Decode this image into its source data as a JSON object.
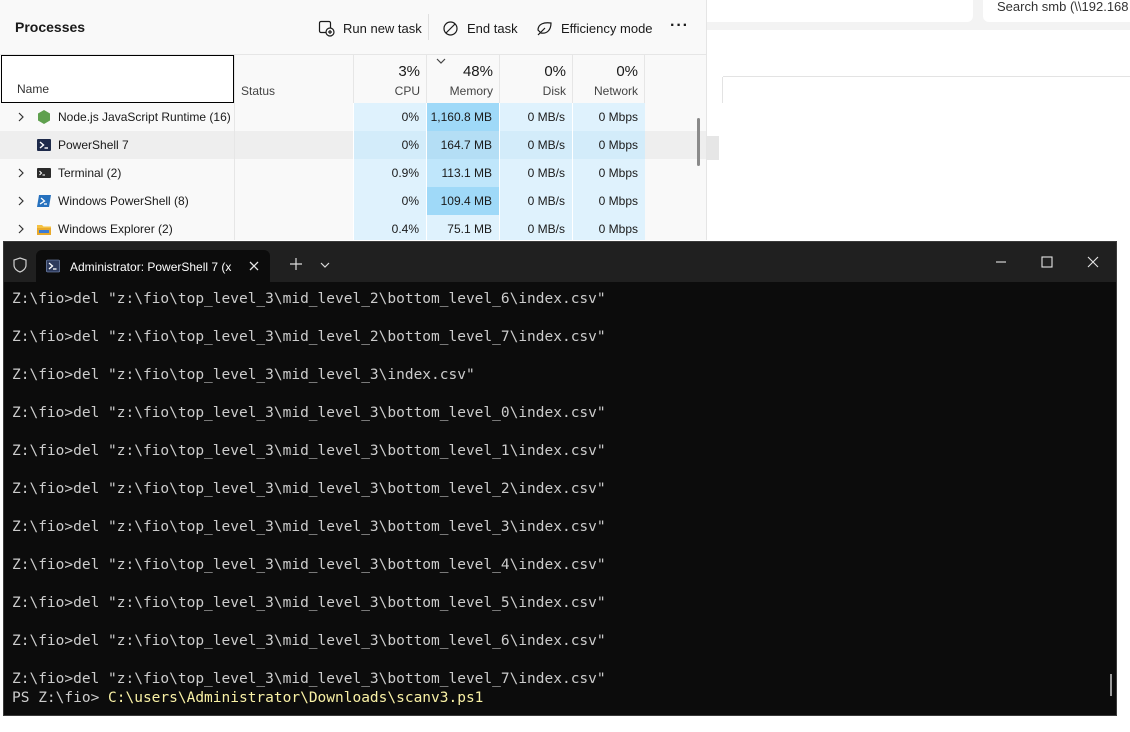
{
  "explorer": {
    "search_placeholder": "Search smb (\\\\192.168"
  },
  "taskmgr": {
    "title": "Processes",
    "commands": {
      "run_new_task": "Run new task",
      "end_task": "End task",
      "efficiency_mode": "Efficiency mode",
      "more": "···"
    },
    "columns": {
      "name": "Name",
      "status": "Status",
      "cpu": {
        "pct": "3%",
        "label": "CPU"
      },
      "memory": {
        "pct": "48%",
        "label": "Memory"
      },
      "disk": {
        "pct": "0%",
        "label": "Disk"
      },
      "network": {
        "pct": "0%",
        "label": "Network"
      }
    },
    "rows": [
      {
        "name": "Node.js JavaScript Runtime (16)",
        "cpu": "0%",
        "memory": "1,160.8 MB",
        "disk": "0 MB/s",
        "network": "0 Mbps",
        "expandable": true,
        "icon": "nodejs-icon"
      },
      {
        "name": "PowerShell 7",
        "cpu": "0%",
        "memory": "164.7 MB",
        "disk": "0 MB/s",
        "network": "0 Mbps",
        "expandable": false,
        "icon": "powershell-icon"
      },
      {
        "name": "Terminal (2)",
        "cpu": "0.9%",
        "memory": "113.1 MB",
        "disk": "0 MB/s",
        "network": "0 Mbps",
        "expandable": true,
        "icon": "terminal-icon"
      },
      {
        "name": "Windows PowerShell (8)",
        "cpu": "0%",
        "memory": "109.4 MB",
        "disk": "0 MB/s",
        "network": "0 Mbps",
        "expandable": true,
        "icon": "windows-powershell-icon"
      },
      {
        "name": "Windows Explorer (2)",
        "cpu": "0.4%",
        "memory": "75.1 MB",
        "disk": "0 MB/s",
        "network": "0 Mbps",
        "expandable": true,
        "icon": "folder-icon"
      }
    ],
    "colors": {
      "heat_light": "#dff2fd",
      "heat_medium": "#bfe6fb",
      "heat_strong": "#9fd9f8"
    }
  },
  "terminal": {
    "tab_title": "Administrator: PowerShell 7 (x",
    "lines": [
      "Z:\\fio>del \"z:\\fio\\top_level_3\\mid_level_2\\bottom_level_6\\index.csv\"",
      "Z:\\fio>del \"z:\\fio\\top_level_3\\mid_level_2\\bottom_level_7\\index.csv\"",
      "Z:\\fio>del \"z:\\fio\\top_level_3\\mid_level_3\\index.csv\"",
      "Z:\\fio>del \"z:\\fio\\top_level_3\\mid_level_3\\bottom_level_0\\index.csv\"",
      "Z:\\fio>del \"z:\\fio\\top_level_3\\mid_level_3\\bottom_level_1\\index.csv\"",
      "Z:\\fio>del \"z:\\fio\\top_level_3\\mid_level_3\\bottom_level_2\\index.csv\"",
      "Z:\\fio>del \"z:\\fio\\top_level_3\\mid_level_3\\bottom_level_3\\index.csv\"",
      "Z:\\fio>del \"z:\\fio\\top_level_3\\mid_level_3\\bottom_level_4\\index.csv\"",
      "Z:\\fio>del \"z:\\fio\\top_level_3\\mid_level_3\\bottom_level_5\\index.csv\"",
      "Z:\\fio>del \"z:\\fio\\top_level_3\\mid_level_3\\bottom_level_6\\index.csv\"",
      "Z:\\fio>del \"z:\\fio\\top_level_3\\mid_level_3\\bottom_level_7\\index.csv\""
    ],
    "prompt": "PS Z:\\fio> ",
    "command": "C:\\users\\Administrator\\Downloads\\scanv3.ps1",
    "colors": {
      "background": "#0c0c0c",
      "text": "#cccccc",
      "command": "#f9f1a5"
    }
  }
}
